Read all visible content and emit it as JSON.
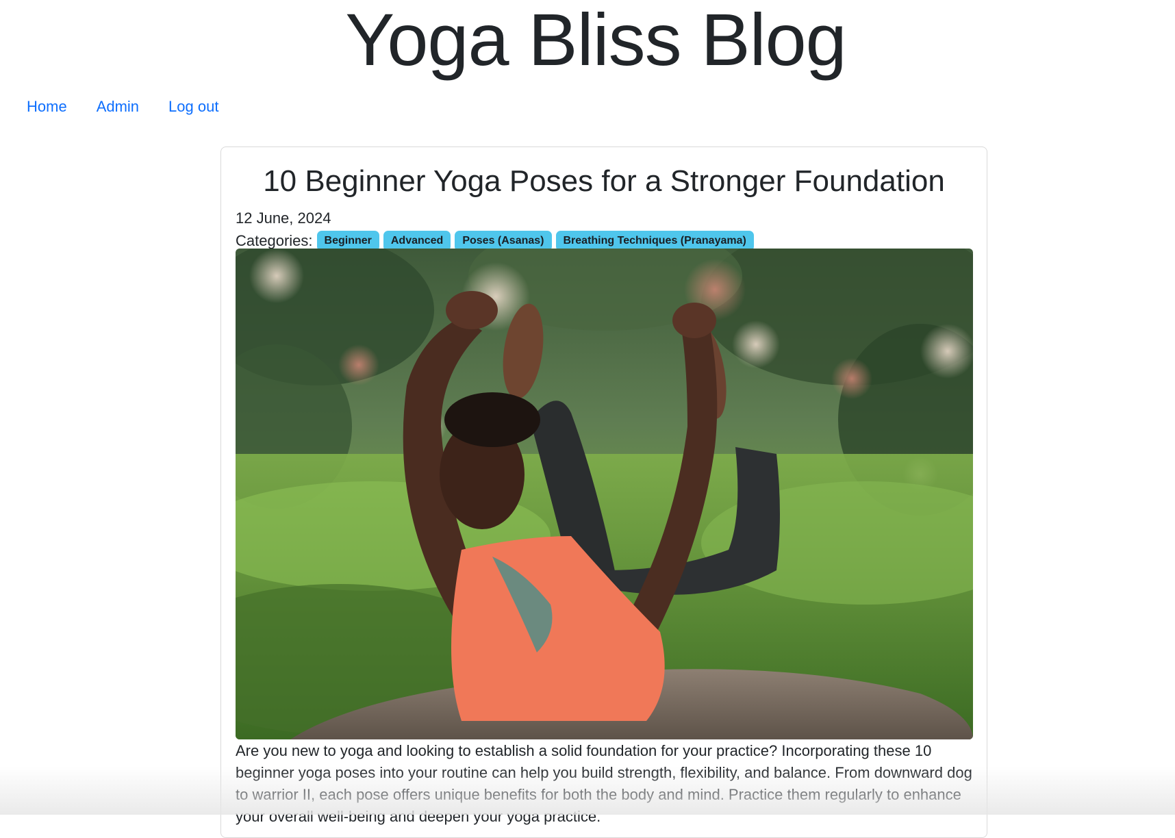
{
  "site": {
    "title": "Yoga Bliss Blog"
  },
  "nav": {
    "items": [
      {
        "label": "Home"
      },
      {
        "label": "Admin"
      },
      {
        "label": "Log out"
      }
    ]
  },
  "post": {
    "title": "10 Beginner Yoga Poses for a Stronger Foundation",
    "date": "12 June, 2024",
    "categories_label": "Categories:",
    "categories": [
      {
        "label": "Beginner"
      },
      {
        "label": "Advanced"
      },
      {
        "label": "Poses (Asanas)"
      },
      {
        "label": "Breathing Techniques (Pranayama)"
      }
    ],
    "body": "Are you new to yoga and looking to establish a solid foundation for your practice? Incorporating these 10 beginner yoga poses into your routine can help you build strength, flexibility, and balance. From downward dog to warrior II, each pose offers unique benefits for both the body and mind. Practice them regularly to enhance your overall well-being and deepen your yoga practice."
  },
  "colors": {
    "link": "#0d6efd",
    "badge": "#4fc6ec",
    "text": "#212529"
  }
}
